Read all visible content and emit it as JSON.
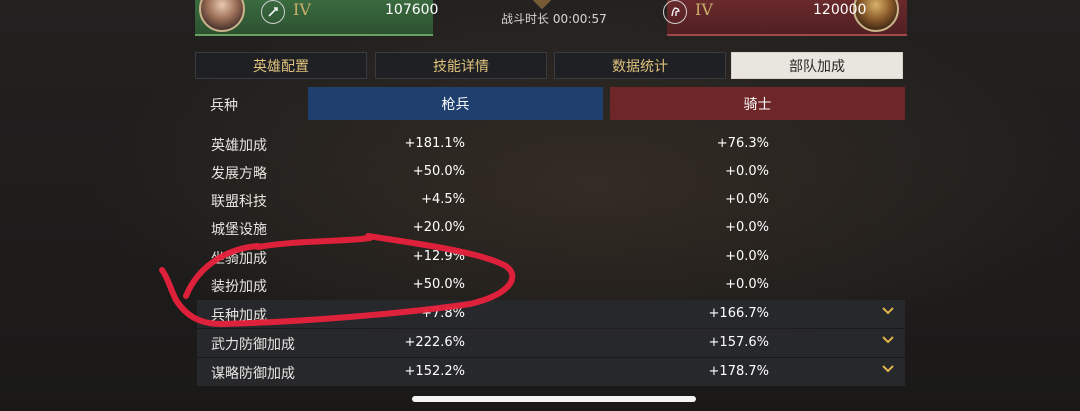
{
  "header": {
    "left": {
      "tier": "IV",
      "power": "107600",
      "icon": "sword-icon"
    },
    "battle_time": "战斗时长 00:00:57",
    "right": {
      "tier": "IV",
      "power": "120000",
      "icon": "horse-icon"
    },
    "colors": {
      "left_bar": "#2c5230",
      "right_bar": "#512022"
    }
  },
  "tabs": [
    {
      "label": "英雄配置",
      "active": false
    },
    {
      "label": "技能详情",
      "active": false
    },
    {
      "label": "数据统计",
      "active": false
    },
    {
      "label": "部队加成",
      "active": true
    }
  ],
  "table": {
    "header_label": "兵种",
    "col_a": "枪兵",
    "col_b": "骑士",
    "colors": {
      "col_a": "#1f3f6e",
      "col_b": "#6f2628"
    },
    "rows": [
      {
        "label": "英雄加成",
        "a": "+181.1%",
        "b": "+76.3%"
      },
      {
        "label": "发展方略",
        "a": "+50.0%",
        "b": "+0.0%"
      },
      {
        "label": "联盟科技",
        "a": "+4.5%",
        "b": "+0.0%"
      },
      {
        "label": "城堡设施",
        "a": "+20.0%",
        "b": "+0.0%"
      },
      {
        "label": "坐骑加成",
        "a": "+12.9%",
        "b": "+0.0%"
      },
      {
        "label": "装扮加成",
        "a": "+50.0%",
        "b": "+0.0%"
      },
      {
        "label": "兵种加成",
        "a": "+7.8%",
        "b": "+166.7%"
      },
      {
        "label": "武力防御加成",
        "a": "+222.6%",
        "b": "+157.6%"
      },
      {
        "label": "谋略防御加成",
        "a": "+152.2%",
        "b": "+178.7%"
      }
    ]
  },
  "annotation": {
    "color": "#e8223c"
  }
}
